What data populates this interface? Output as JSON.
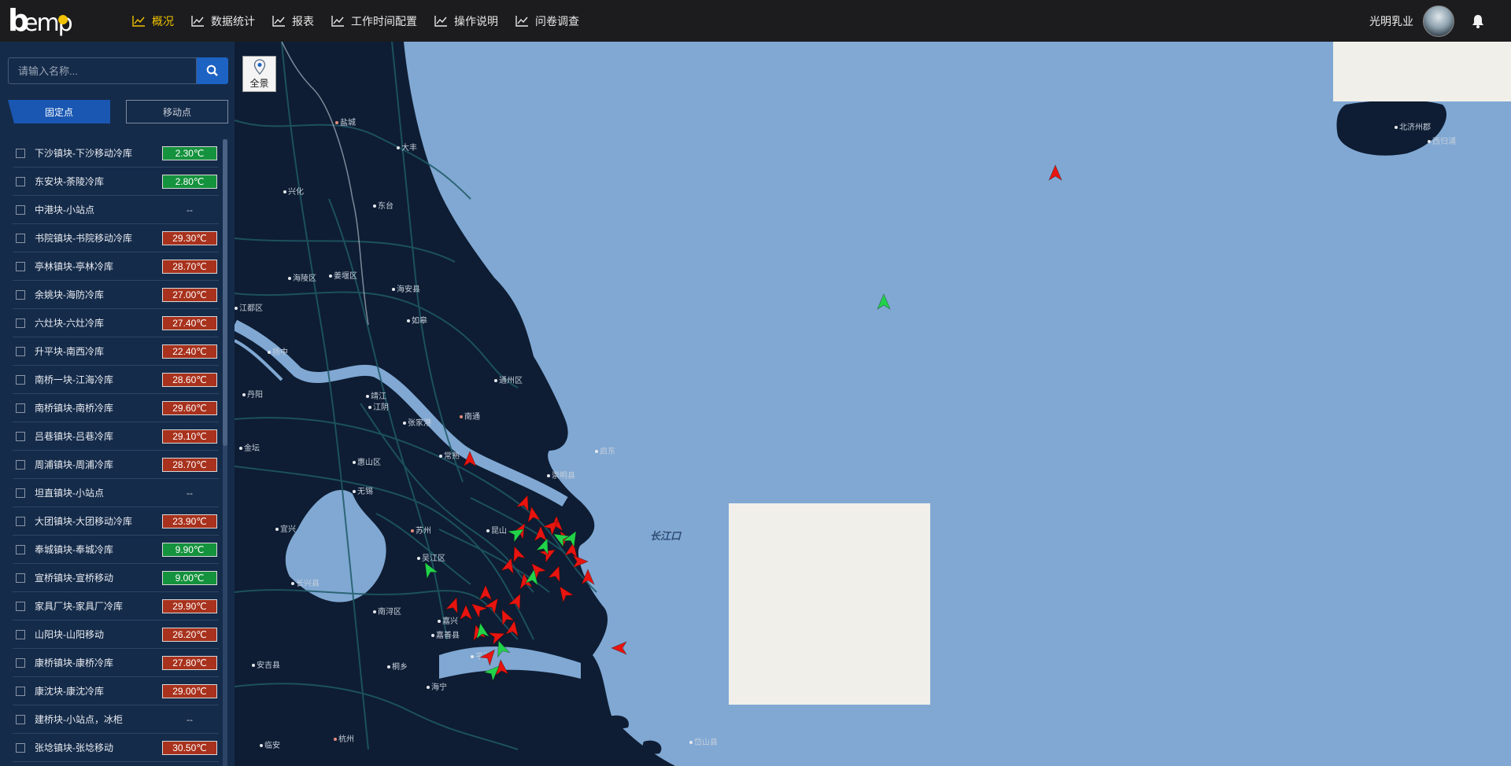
{
  "header": {
    "logo_text": "bemp",
    "nav": [
      {
        "label": "概况",
        "active": true
      },
      {
        "label": "数据统计",
        "active": false
      },
      {
        "label": "报表",
        "active": false
      },
      {
        "label": "工作时间配置",
        "active": false
      },
      {
        "label": "操作说明",
        "active": false
      },
      {
        "label": "问卷调查",
        "active": false
      }
    ],
    "user_name": "光明乳业",
    "active_color": "#f0c200"
  },
  "sidebar": {
    "search": {
      "placeholder": "请输入名称..."
    },
    "tabs": {
      "fixed": "固定点",
      "mobile": "移动点",
      "active": "fixed"
    },
    "items": [
      {
        "name": "下沙镇块-下沙移动冷库",
        "temp": "2.30℃",
        "status": "ok"
      },
      {
        "name": "东安块-荼陵冷库",
        "temp": "2.80℃",
        "status": "ok"
      },
      {
        "name": "中港块-小站点",
        "temp": "--",
        "status": "none"
      },
      {
        "name": "书院镇块-书院移动冷库",
        "temp": "29.30℃",
        "status": "hot"
      },
      {
        "name": "亭林镇块-亭林冷库",
        "temp": "28.70℃",
        "status": "hot"
      },
      {
        "name": "余姚块-海防冷库",
        "temp": "27.00℃",
        "status": "hot"
      },
      {
        "name": "六灶块-六灶冷库",
        "temp": "27.40℃",
        "status": "hot"
      },
      {
        "name": "升平块-南西冷库",
        "temp": "22.40℃",
        "status": "hot"
      },
      {
        "name": "南桥一块-江海冷库",
        "temp": "28.60℃",
        "status": "hot"
      },
      {
        "name": "南桥镇块-南桥冷库",
        "temp": "29.60℃",
        "status": "hot"
      },
      {
        "name": "吕巷镇块-吕巷冷库",
        "temp": "29.10℃",
        "status": "hot"
      },
      {
        "name": "周浦镇块-周浦冷库",
        "temp": "28.70℃",
        "status": "hot"
      },
      {
        "name": "坦直镇块-小站点",
        "temp": "--",
        "status": "none"
      },
      {
        "name": "大团镇块-大团移动冷库",
        "temp": "23.90℃",
        "status": "hot"
      },
      {
        "name": "奉城镇块-奉城冷库",
        "temp": "9.90℃",
        "status": "ok"
      },
      {
        "name": "宣桥镇块-宣桥移动",
        "temp": "9.00℃",
        "status": "ok"
      },
      {
        "name": "家具厂块-家具厂冷库",
        "temp": "29.90℃",
        "status": "hot"
      },
      {
        "name": "山阳块-山阳移动",
        "temp": "26.20℃",
        "status": "hot"
      },
      {
        "name": "康桥镇块-康桥冷库",
        "temp": "27.80℃",
        "status": "hot"
      },
      {
        "name": "康沈块-康沈冷库",
        "temp": "29.00℃",
        "status": "hot"
      },
      {
        "name": "建桥块-小站点，冰柜",
        "temp": "--",
        "status": "none"
      },
      {
        "name": "张埝镇块-张埝移动",
        "temp": "30.50℃",
        "status": "hot"
      }
    ]
  },
  "map": {
    "overview_label": "全景",
    "sea_label": "长江口",
    "cities": [
      "盐城",
      "大丰",
      "兴化",
      "东台",
      "海陵区",
      "姜堰区",
      "海安县",
      "江都区",
      "如皋",
      "扬中",
      "丹阳",
      "靖江",
      "江阴",
      "南通",
      "通州区",
      "张家港",
      "启东",
      "金坛",
      "惠山区",
      "常熟",
      "崇明县",
      "无锡",
      "昆山",
      "宜兴",
      "苏州",
      "吴江区",
      "长兴县",
      "南浔区",
      "嘉兴",
      "嘉善县",
      "平湖",
      "桐乡",
      "海宁",
      "安吉县",
      "临安",
      "杭州",
      "岱山县",
      "北济州郡",
      "西归浦"
    ],
    "colors": {
      "sea": "#80a8d3",
      "land": "#0e1d33",
      "road": "#1f5a66",
      "alarm": "#e8140f",
      "normal": "#22d34a"
    }
  }
}
